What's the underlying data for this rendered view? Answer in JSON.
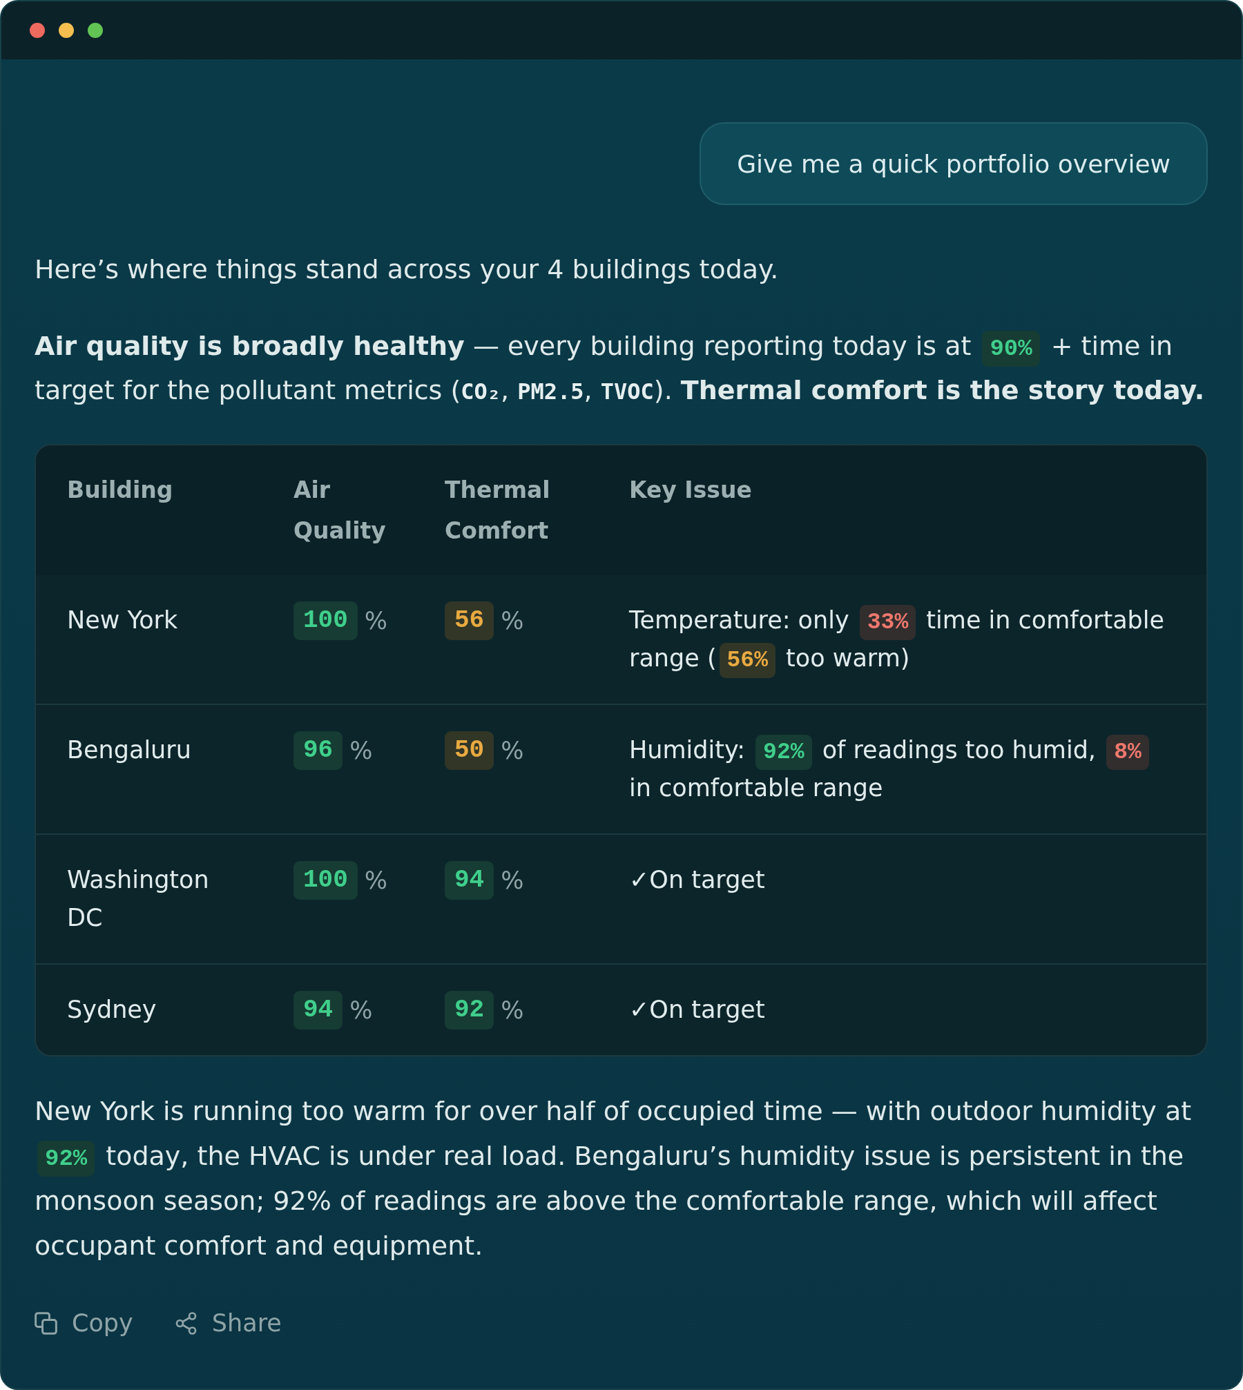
{
  "user_message": {
    "text": "Give me a quick portfolio overview"
  },
  "reply": {
    "intro": "Here’s where things stand across your 4 buildings today.",
    "summary": [
      {
        "kind": "bold",
        "text": "Air quality is broadly healthy"
      },
      {
        "kind": "text",
        "text": " — every building reporting today is at "
      },
      {
        "kind": "badge",
        "color": "#163c33",
        "text": "90%"
      },
      {
        "kind": "text",
        "text": " + time in target for the pollutant metrics ("
      },
      {
        "kind": "code",
        "text": "CO₂"
      },
      {
        "kind": "text",
        "text": ", "
      },
      {
        "kind": "code",
        "text": "PM2.5"
      },
      {
        "kind": "text",
        "text": ", "
      },
      {
        "kind": "code",
        "text": "TVOC"
      },
      {
        "kind": "text",
        "text": "). "
      },
      {
        "kind": "bold",
        "text": "Thermal comfort is the story today."
      }
    ],
    "table": {
      "columns": [
        "Building",
        "Air Quality",
        "Thermal Comfort",
        "Key Issue"
      ],
      "rows": [
        {
          "building": "New York",
          "air_quality": {
            "value": "100",
            "unit": "%",
            "color": "#163c33"
          },
          "thermal_comfort": {
            "value": "56",
            "unit": "%",
            "color": "#313627"
          },
          "key_issue": [
            {
              "kind": "text",
              "text": "Temperature: only "
            },
            {
              "kind": "badge",
              "color": "#322e2e",
              "text": "33%"
            },
            {
              "kind": "text",
              "text": " time in comfortable range ("
            },
            {
              "kind": "badge",
              "color": "#313627",
              "text": "56%"
            },
            {
              "kind": "text",
              "text": " too warm)"
            }
          ]
        },
        {
          "building": "Bengaluru",
          "air_quality": {
            "value": "96",
            "unit": "%",
            "color": "#163c33"
          },
          "thermal_comfort": {
            "value": "50",
            "unit": "%",
            "color": "#313627"
          },
          "key_issue": [
            {
              "kind": "text",
              "text": "Humidity: "
            },
            {
              "kind": "badge",
              "color": "#163c33",
              "text": "92%"
            },
            {
              "kind": "text",
              "text": " of readings too humid, "
            },
            {
              "kind": "badge",
              "color": "#322e2e",
              "text": "8%"
            },
            {
              "kind": "text",
              "text": " in comfortable range"
            }
          ]
        },
        {
          "building": "Washington DC",
          "air_quality": {
            "value": "100",
            "unit": "%",
            "color": "#163c33"
          },
          "thermal_comfort": {
            "value": "94",
            "unit": "%",
            "color": "#163c33"
          },
          "key_issue": [
            {
              "kind": "text",
              "text": "✓On target"
            }
          ]
        },
        {
          "building": "Sydney",
          "air_quality": {
            "value": "94",
            "unit": "%",
            "color": "#163c33"
          },
          "thermal_comfort": {
            "value": "92",
            "unit": "%",
            "color": "#163c33"
          },
          "key_issue": [
            {
              "kind": "text",
              "text": "✓On target"
            }
          ]
        }
      ]
    },
    "closing": [
      {
        "kind": "text",
        "text": "New York is running too warm for over half of occupied time — with outdoor humidity at "
      },
      {
        "kind": "badge",
        "color": "#163c33",
        "text": "92%"
      },
      {
        "kind": "text",
        "text": " today, the HVAC is under real load. Bengaluru’s humidity issue is persistent in the monsoon season; 92% of readings are above the comfortable range, which will affect occupant comfort and equipment."
      }
    ],
    "actions": [
      {
        "kind": "copy",
        "label": "Copy"
      },
      {
        "kind": "share",
        "label": "Share"
      }
    ]
  }
}
